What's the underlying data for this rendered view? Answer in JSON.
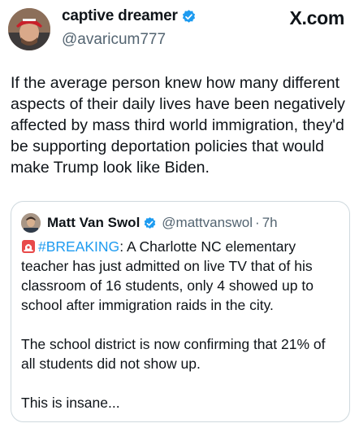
{
  "author": {
    "display_name": "captive dreamer",
    "handle": "@avaricum777",
    "verified": true
  },
  "brand": "X.com",
  "tweet_text": "If the average person knew how many different aspects of their daily lives have been negatively affected by mass third world immigration, they'd be supporting deportation policies that would make Trump look like Biden.",
  "quote": {
    "display_name": "Matt Van Swol",
    "handle": "@mattvanswol",
    "separator": "·",
    "time": "7h",
    "verified": true,
    "hashtag": "#BREAKING",
    "para1_rest": ": A Charlotte NC elementary teacher has just admitted on live TV that of his classroom of 16 students, only 4 showed up to school after immigration raids in the city.",
    "para2": "The school district is now confirming that 21% of all students did not show up.",
    "para3": "This is insane..."
  },
  "colors": {
    "verified_blue": "#1d9bf0",
    "hashtag_blue": "#1d9bf0",
    "secondary_text": "#536471",
    "border": "#cfd9de"
  },
  "icons": {
    "verified": "verified-badge-icon",
    "siren": "police-siren-icon"
  }
}
